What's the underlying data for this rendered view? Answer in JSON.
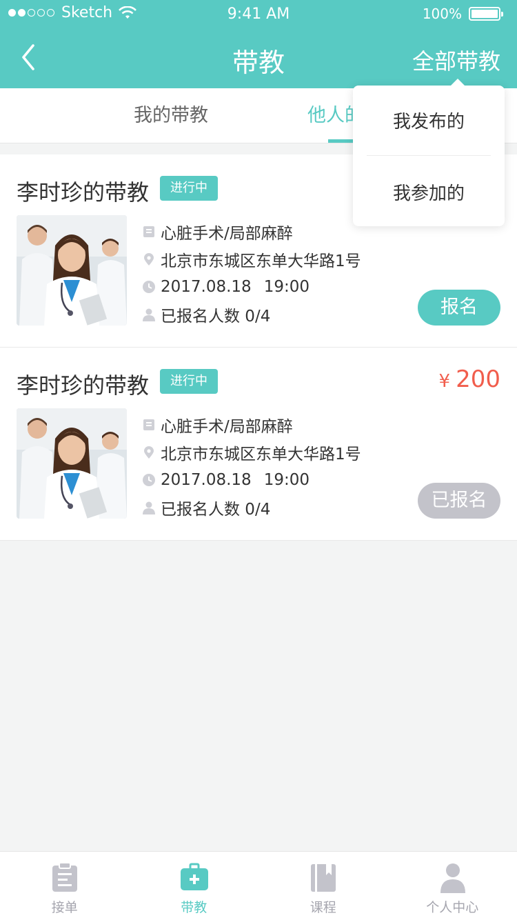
{
  "status_bar": {
    "carrier": "Sketch",
    "time": "9:41 AM",
    "battery": "100%"
  },
  "nav": {
    "title": "带教",
    "right_label": "全部带教"
  },
  "tabs": [
    {
      "label": "我的带教"
    },
    {
      "label": "他人的带教"
    }
  ],
  "cards": [
    {
      "title": "李时珍的带教",
      "status": "进行中",
      "price": "",
      "topic": "心脏手术/局部麻醉",
      "address": "北京市东城区东单大华路1号",
      "date": "2017.08.18",
      "time": "19:00",
      "enrolled": "已报名人数 0/4",
      "button": "报名",
      "button_state": "active"
    },
    {
      "title": "李时珍的带教",
      "status": "进行中",
      "price_currency": "¥",
      "price": "200",
      "topic": "心脏手术/局部麻醉",
      "address": "北京市东城区东单大华路1号",
      "date": "2017.08.18",
      "time": "19:00",
      "enrolled": "已报名人数 0/4",
      "button": "已报名",
      "button_state": "disabled"
    }
  ],
  "dropdown": {
    "items": [
      "我发布的",
      "我参加的"
    ]
  },
  "tabbar": [
    {
      "label": "接单",
      "icon": "clipboard-icon",
      "active": false
    },
    {
      "label": "带教",
      "icon": "medical-kit-icon",
      "active": true
    },
    {
      "label": "课程",
      "icon": "book-icon",
      "active": false
    },
    {
      "label": "个人中心",
      "icon": "person-icon",
      "active": false
    }
  ],
  "colors": {
    "primary": "#58cac3",
    "price": "#f15d4c",
    "disabled": "#c3c3ca",
    "inactive": "#a5a5ae"
  }
}
